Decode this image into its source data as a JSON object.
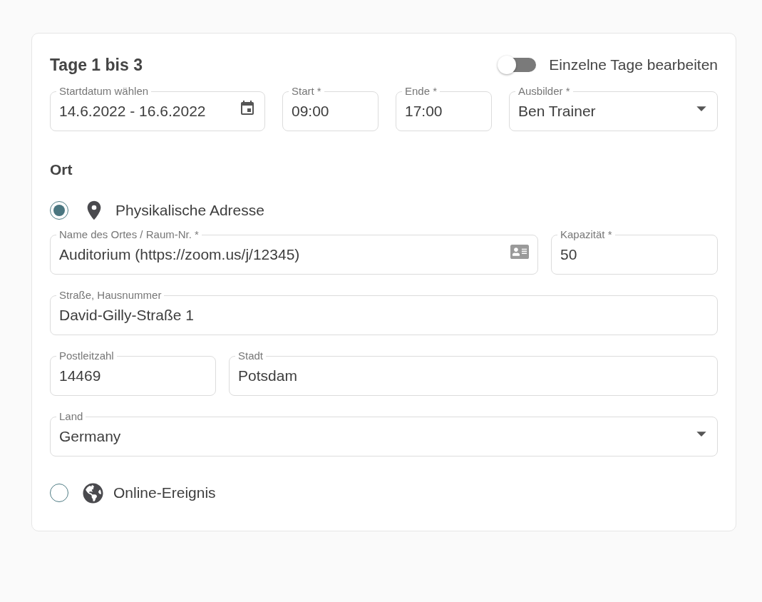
{
  "header": {
    "title": "Tage 1 bis 3",
    "toggle": {
      "label": "Einzelne Tage bearbeiten",
      "on": false
    }
  },
  "schedule_fields": [
    {
      "kind": "date",
      "label": "Startdatum wählen",
      "value": "14.6.2022 - 16.6.2022"
    },
    {
      "kind": "text",
      "label": "Start *",
      "value": "09:00"
    },
    {
      "kind": "text",
      "label": "Ende *",
      "value": "17:00"
    },
    {
      "kind": "select",
      "label": "Ausbilder *",
      "value": "Ben Trainer"
    }
  ],
  "location": {
    "title": "Ort",
    "options": [
      {
        "kind": "physical",
        "label": "Physikalische Adresse",
        "selected": true,
        "field_rows": [
          [
            {
              "kind": "card",
              "label": "Name des Ortes / Raum-Nr. *",
              "value": "Auditorium (https://zoom.us/j/12345)"
            },
            {
              "kind": "text",
              "label": "Kapazität *",
              "value": "50"
            }
          ],
          [
            {
              "kind": "text",
              "label": "Straße, Hausnummer",
              "value": "David-Gilly-Straße 1"
            }
          ],
          [
            {
              "kind": "text",
              "label": "Postleitzahl",
              "value": "14469"
            },
            {
              "kind": "text",
              "label": "Stadt",
              "value": "Potsdam"
            }
          ],
          [
            {
              "kind": "select",
              "label": "Land",
              "value": "Germany"
            }
          ]
        ]
      },
      {
        "kind": "online",
        "label": "Online-Ereignis",
        "selected": false
      }
    ]
  }
}
